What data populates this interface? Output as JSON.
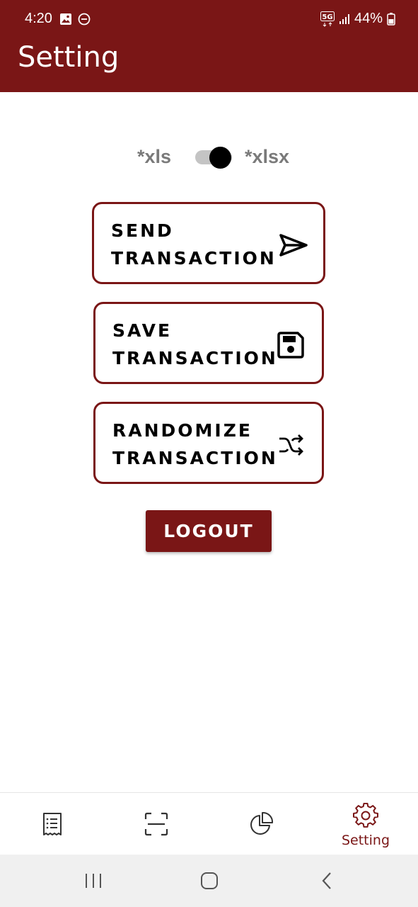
{
  "status_bar": {
    "time": "4:20",
    "network": "5G",
    "battery": "44%"
  },
  "header": {
    "title": "Setting"
  },
  "export_format": {
    "left_label": "*xls",
    "right_label": "*xlsx",
    "selected": "*xlsx"
  },
  "actions": {
    "send_line1": "SEND",
    "send_line2": "TRANSACTION",
    "save_line1": "SAVE",
    "save_line2": "TRANSACTION",
    "randomize_line1": "RANDOMIZE",
    "randomize_line2": "TRANSACTION"
  },
  "logout_label": "LOGOUT",
  "bottom_nav": {
    "active_label": "Setting",
    "items": [
      {
        "icon": "receipt-list-icon"
      },
      {
        "icon": "scan-frame-icon"
      },
      {
        "icon": "pie-chart-icon"
      },
      {
        "icon": "gear-icon",
        "label": "Setting"
      }
    ]
  },
  "colors": {
    "primary": "#7a1616",
    "muted_text": "#7a7a7a",
    "toggle_track": "#c4c4c4",
    "system_nav_bg": "#f0f0f0"
  }
}
